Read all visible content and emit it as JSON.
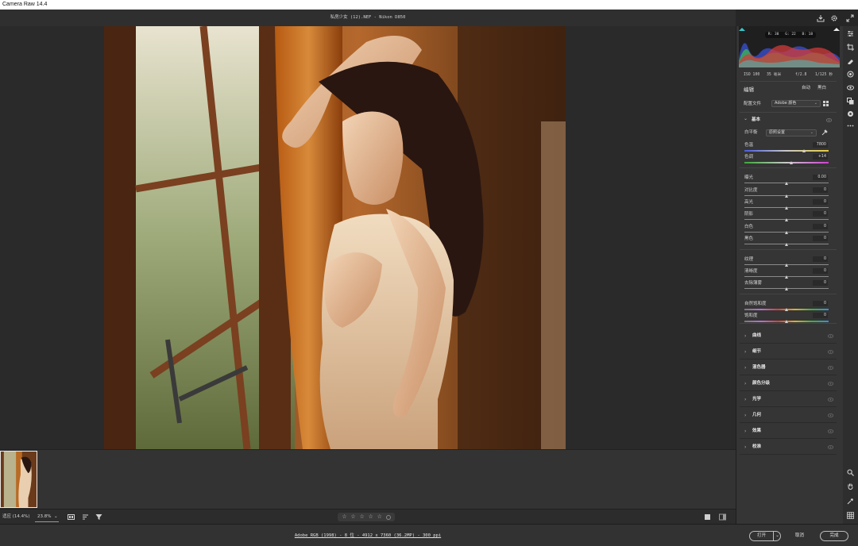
{
  "app": {
    "title": "Camera Raw 14.4"
  },
  "header": {
    "document_title": "私房少女 (12).NEF - Nikon D850",
    "icons": [
      "save-icon",
      "gear-icon",
      "fullscreen-icon"
    ]
  },
  "filmstrip": {
    "thumbnail_icon": "photo-thumbnail"
  },
  "bottom_toolbar": {
    "fit_label": "适应 (14.4%)",
    "zoom_value": "23.8%",
    "icons": [
      "filmstrip-toggle-icon",
      "sort-icon",
      "filter-icon",
      "compare-view-icon",
      "before-after-icon"
    ],
    "rating": {
      "stars": 5,
      "filled": 0
    }
  },
  "status_bar": {
    "workflow_link": "Adobe RGB (1998) - 8 位 - 4912 x 7360 (36.2MP) - 300 ppi",
    "open_label": "打开",
    "cancel_label": "取消",
    "done_label": "完成"
  },
  "histogram": {
    "r": "R: 38",
    "g": "G: 22",
    "b": "B: 18",
    "colors": {
      "red": "#d23b3b",
      "green": "#3cc24a",
      "blue": "#3a52d6",
      "cyan": "#3ac7c7"
    }
  },
  "exif": {
    "iso": "ISO 100",
    "focal": "35 毫米",
    "aperture": "f/2.8",
    "shutter": "1/125 秒"
  },
  "edit": {
    "heading": "编辑",
    "auto_label": "自动",
    "bw_label": "黑白",
    "profile_label": "配置文件",
    "profile_value": "Adobe 颜色"
  },
  "basic": {
    "title": "基本",
    "wb_label": "白平衡",
    "wb_value": "原照设置",
    "sliders": [
      {
        "label": "色温",
        "value": "7800",
        "position": 0.71,
        "track": "temp"
      },
      {
        "label": "色调",
        "value": "+14",
        "position": 0.56,
        "track": "tint"
      },
      {
        "label": "曝光",
        "value": "0.00",
        "position": 0.5,
        "track": "plain"
      },
      {
        "label": "对比度",
        "value": "0",
        "position": 0.5,
        "track": "plain"
      },
      {
        "label": "高光",
        "value": "0",
        "position": 0.5,
        "track": "plain"
      },
      {
        "label": "阴影",
        "value": "0",
        "position": 0.5,
        "track": "plain"
      },
      {
        "label": "白色",
        "value": "0",
        "position": 0.5,
        "track": "plain"
      },
      {
        "label": "黑色",
        "value": "0",
        "position": 0.5,
        "track": "plain"
      },
      {
        "label": "纹理",
        "value": "0",
        "position": 0.5,
        "track": "plain"
      },
      {
        "label": "清晰度",
        "value": "0",
        "position": 0.5,
        "track": "plain"
      },
      {
        "label": "去除薄雾",
        "value": "0",
        "position": 0.5,
        "track": "plain"
      },
      {
        "label": "自然饱和度",
        "value": "0",
        "position": 0.5,
        "track": "vib"
      },
      {
        "label": "饱和度",
        "value": "0",
        "position": 0.5,
        "track": "vib"
      }
    ]
  },
  "sections": [
    "曲线",
    "细节",
    "混色器",
    "颜色分级",
    "光学",
    "几何",
    "效果",
    "校准"
  ],
  "tool_icons": [
    "edit-sliders-icon",
    "crop-icon",
    "healing-brush-icon",
    "masking-icon",
    "red-eye-icon",
    "presets-icon",
    "snapshots-icon",
    "more-icon",
    "zoom-icon",
    "hand-icon",
    "sampler-icon",
    "grid-icon"
  ]
}
